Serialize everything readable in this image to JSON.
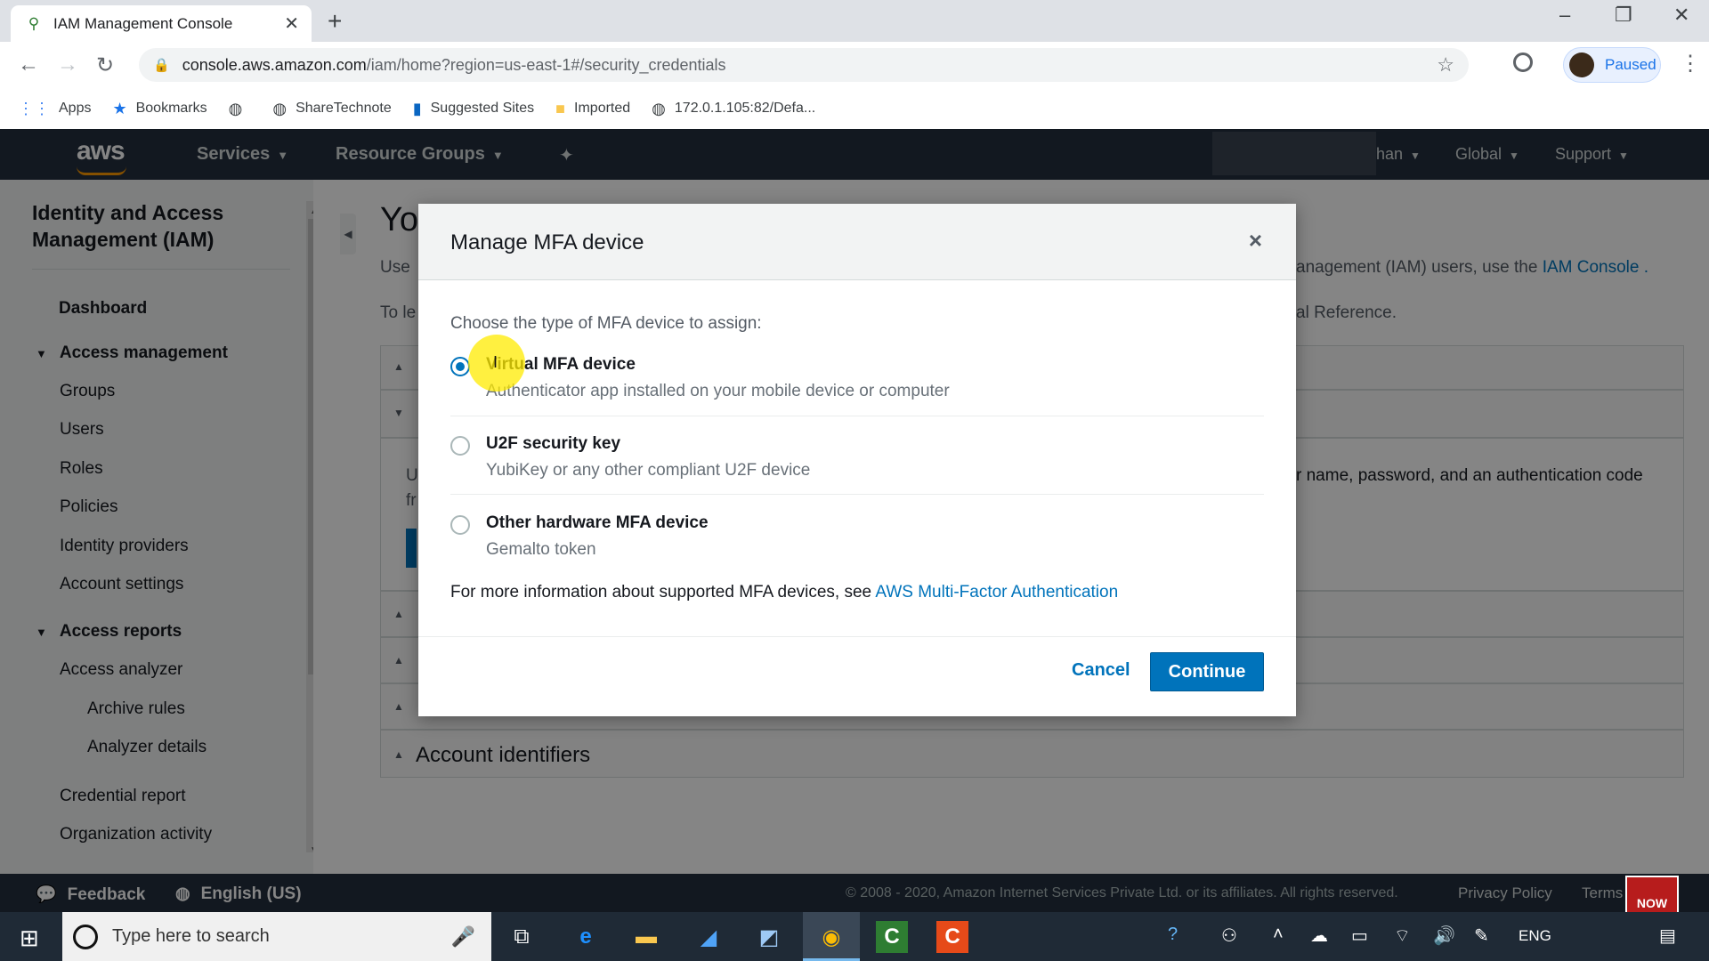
{
  "browser": {
    "tab_title": "IAM Management Console",
    "url_host": "console.aws.amazon.com",
    "url_path": "/iam/home?region=us-east-1#/security_credentials",
    "profile_label": "Paused",
    "bookmarks": [
      "Apps",
      "Bookmarks",
      "ShareTechnote",
      "Suggested Sites",
      "Imported",
      "172.0.1.105:82/Defa..."
    ]
  },
  "aws_nav": {
    "logo": "aws",
    "services": "Services",
    "resource_groups": "Resource Groups",
    "account_suffix": "han",
    "region": "Global",
    "support": "Support"
  },
  "sidebar": {
    "title": "Identity and Access Management (IAM)",
    "dashboard": "Dashboard",
    "access_management": "Access management",
    "am_items": [
      "Groups",
      "Users",
      "Roles",
      "Policies",
      "Identity providers",
      "Account settings"
    ],
    "access_reports": "Access reports",
    "ar_items": [
      "Access analyzer",
      "Archive rules",
      "Analyzer details",
      "Credential report",
      "Organization activity"
    ]
  },
  "main": {
    "heading_fragment": "Yo",
    "p1_left": "Use",
    "p1_right": "anagement (IAM) users, use the ",
    "p1_link": "IAM Console",
    "p1_end": " .",
    "p2_left": "To le",
    "p2_right": "al Reference.",
    "p3_left": "U",
    "p3_left2": "fr",
    "p3_right": "r name, password, and an authentication code",
    "account_identifiers": "Account identifiers"
  },
  "modal": {
    "title": "Manage MFA device",
    "close": "×",
    "prompt": "Choose the type of MFA device to assign:",
    "options": [
      {
        "name": "Virtual MFA device",
        "desc": "Authenticator app installed on your mobile device or computer",
        "selected": true
      },
      {
        "name": "U2F security key",
        "desc": "YubiKey or any other compliant U2F device",
        "selected": false
      },
      {
        "name": "Other hardware MFA device",
        "desc": "Gemalto token",
        "selected": false
      }
    ],
    "info_text": "For more information about supported MFA devices, see ",
    "info_link": "AWS Multi-Factor Authentication",
    "cancel": "Cancel",
    "continue": "Continue"
  },
  "aws_footer": {
    "feedback": "Feedback",
    "language": "English (US)",
    "copyright": "© 2008 - 2020, Amazon Internet Services Private Ltd. or its affiliates. All rights reserved.",
    "privacy": "Privacy Policy",
    "terms": "Terms",
    "subscribe": "NOW"
  },
  "taskbar": {
    "search_placeholder": "Type here to search",
    "language": "ENG"
  },
  "colors": {
    "aws_nav": "#232f3e",
    "aws_orange": "#ff9900",
    "primary_blue": "#0073bb"
  }
}
